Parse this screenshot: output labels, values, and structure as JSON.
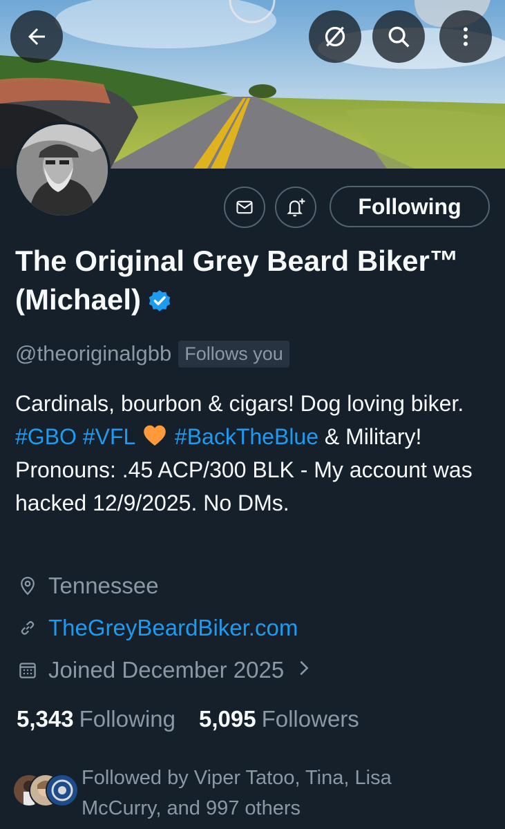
{
  "profile": {
    "display_name": "The Original Grey Beard Biker™ (Michael)",
    "handle": "@theoriginalgbb",
    "follows_you": "Follows you",
    "verified": true,
    "bio": {
      "t1": "Cardinals, bourbon & cigars! Dog loving biker. ",
      "tag1": "#GBO",
      "t2": " ",
      "tag2": "#VFL",
      "t3": " ",
      "tag3": "#BackTheBlue",
      "t4": " & Military! Pronouns: .45 ACP/300 BLK - My account was hacked 12/9/2025. No DMs."
    },
    "location": "Tennessee",
    "website": "TheGreyBeardBiker.com",
    "joined": "Joined December 2025",
    "following_count": "5,343",
    "following_label": "Following",
    "followers_count": "5,095",
    "followers_label": "Followers",
    "followed_by": "Followed by Viper Tatoo, Tina, Lisa McCurry, and 997 others"
  },
  "actions": {
    "following_button": "Following"
  },
  "icons": {
    "back": "arrow-left-icon",
    "no_follow": "slash-circle-icon",
    "search": "search-icon",
    "more": "more-vertical-icon",
    "message": "envelope-icon",
    "notify": "bell-plus-icon",
    "verified": "verified-badge-icon",
    "heart": "orange-heart-emoji",
    "location": "location-pin-icon",
    "link": "link-icon",
    "calendar": "calendar-icon",
    "chevron": "chevron-right-icon"
  },
  "colors": {
    "background": "#15202b",
    "accent": "#1d9bf0",
    "secondary_text": "#8b98a5",
    "primary_text": "#f7f9f9"
  }
}
